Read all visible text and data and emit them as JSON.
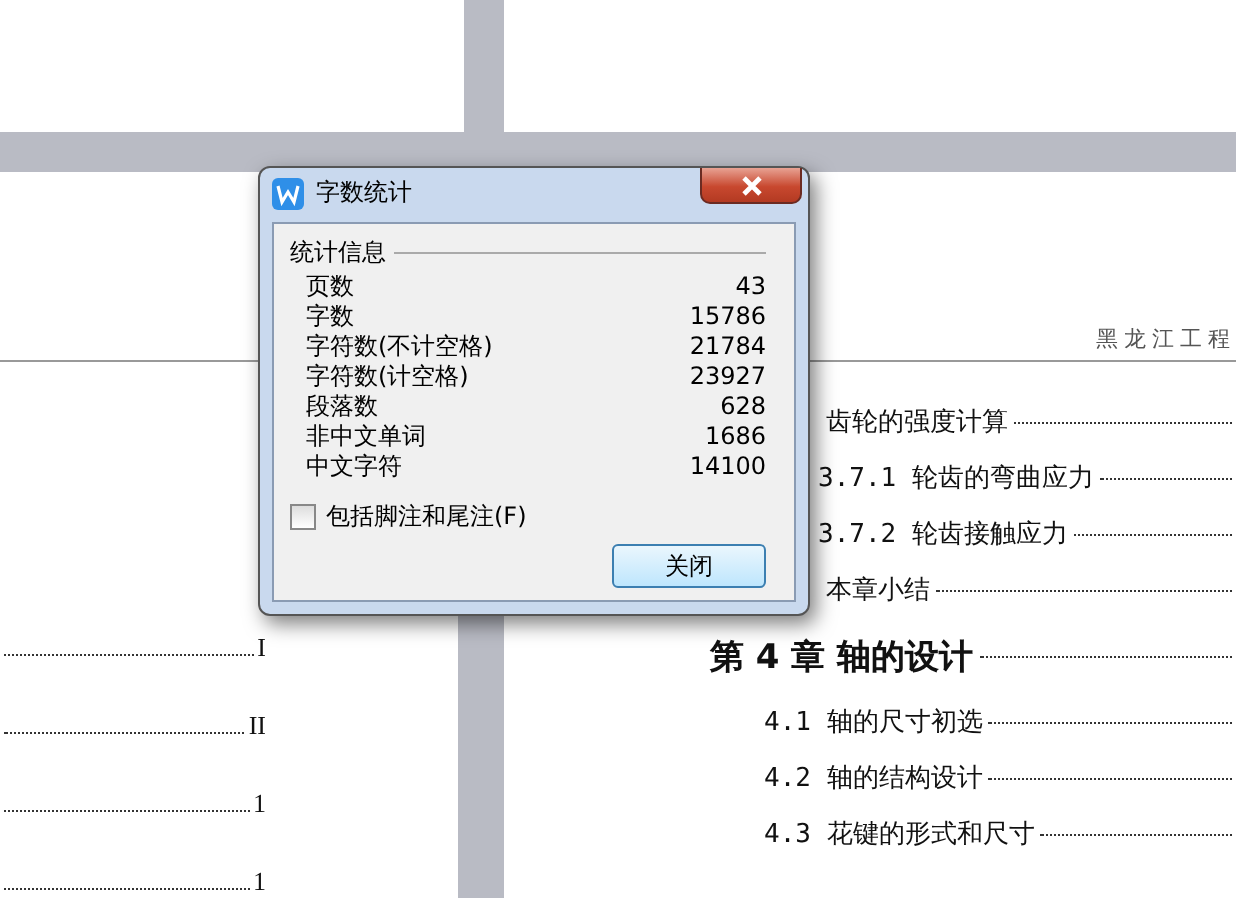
{
  "left_page": {
    "toc_page_numbers": [
      "I",
      "II",
      "1",
      "1"
    ]
  },
  "right_page": {
    "header": "黑龙江工程",
    "toc": [
      {
        "kind": "partial",
        "text": "齿轮的强度计算"
      },
      {
        "kind": "subsection",
        "text": "3.7.1 轮齿的弯曲应力"
      },
      {
        "kind": "subsection",
        "text": "3.7.2 轮齿接触应力"
      },
      {
        "kind": "partial",
        "text": "本章小结"
      },
      {
        "kind": "chapter",
        "text": "第 4 章  轴的设计"
      },
      {
        "kind": "section",
        "text": "4.1 轴的尺寸初选"
      },
      {
        "kind": "section",
        "text": "4.2 轴的结构设计"
      },
      {
        "kind": "section",
        "text": "4.3 花键的形式和尺寸"
      }
    ]
  },
  "dialog": {
    "title": "字数统计",
    "group_title": "统计信息",
    "stats": [
      {
        "label": "页数",
        "value": "43"
      },
      {
        "label": "字数",
        "value": "15786"
      },
      {
        "label": "字符数(不计空格)",
        "value": "21784"
      },
      {
        "label": "字符数(计空格)",
        "value": "23927"
      },
      {
        "label": "段落数",
        "value": "628"
      },
      {
        "label": "非中文单词",
        "value": "1686"
      },
      {
        "label": "中文字符",
        "value": "14100"
      }
    ],
    "checkbox": {
      "label": "包括脚注和尾注(F)",
      "checked": false
    },
    "button": "关闭"
  }
}
